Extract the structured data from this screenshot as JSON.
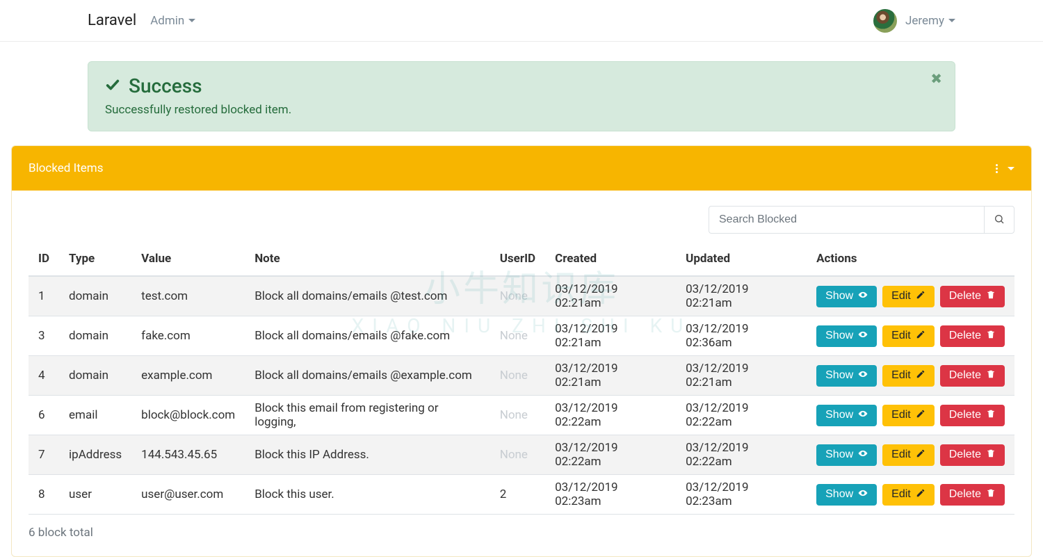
{
  "nav": {
    "brand": "Laravel",
    "admin": "Admin",
    "user": "Jeremy"
  },
  "alert": {
    "title": "Success",
    "message": "Successfully restored blocked item."
  },
  "card": {
    "title": "Blocked Items",
    "search_placeholder": "Search Blocked",
    "total_text": "6 block total"
  },
  "columns": {
    "id": "ID",
    "type": "Type",
    "value": "Value",
    "note": "Note",
    "userid": "UserID",
    "created": "Created",
    "updated": "Updated",
    "actions": "Actions"
  },
  "actions": {
    "show": "Show",
    "edit": "Edit",
    "delete": "Delete"
  },
  "none_label": "None",
  "rows": [
    {
      "id": "1",
      "type": "domain",
      "value": "test.com",
      "note": "Block all domains/emails @test.com",
      "userid": null,
      "created": "03/12/2019 02:21am",
      "updated": "03/12/2019 02:21am"
    },
    {
      "id": "3",
      "type": "domain",
      "value": "fake.com",
      "note": "Block all domains/emails @fake.com",
      "userid": null,
      "created": "03/12/2019 02:21am",
      "updated": "03/12/2019 02:36am"
    },
    {
      "id": "4",
      "type": "domain",
      "value": "example.com",
      "note": "Block all domains/emails @example.com",
      "userid": null,
      "created": "03/12/2019 02:21am",
      "updated": "03/12/2019 02:21am"
    },
    {
      "id": "6",
      "type": "email",
      "value": "block@block.com",
      "note": "Block this email from registering or logging,",
      "userid": null,
      "created": "03/12/2019 02:22am",
      "updated": "03/12/2019 02:22am"
    },
    {
      "id": "7",
      "type": "ipAddress",
      "value": "144.543.45.65",
      "note": "Block this IP Address.",
      "userid": null,
      "created": "03/12/2019 02:22am",
      "updated": "03/12/2019 02:22am"
    },
    {
      "id": "8",
      "type": "user",
      "value": "user@user.com",
      "note": "Block this user.",
      "userid": "2",
      "created": "03/12/2019 02:23am",
      "updated": "03/12/2019 02:23am"
    }
  ],
  "watermark": {
    "line1": "小牛知识库",
    "line2": "XIAO NIU ZHI SHI KU"
  }
}
